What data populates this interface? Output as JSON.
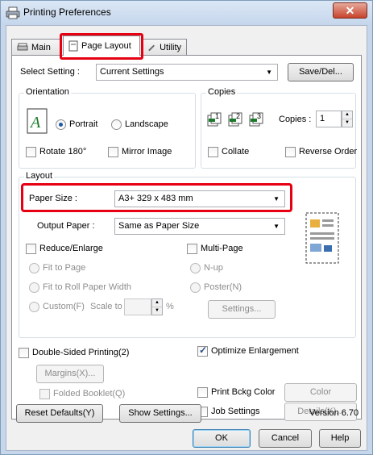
{
  "window": {
    "title": "Printing Preferences",
    "close_glyph": "✕"
  },
  "tabs": [
    "Main",
    "Page Layout",
    "Utility"
  ],
  "select_setting": {
    "label": "Select Setting :",
    "value": "Current Settings",
    "save_button": "Save/Del..."
  },
  "orientation": {
    "group_title": "Orientation",
    "portrait": "Portrait",
    "landscape": "Landscape",
    "selected": "Portrait",
    "rotate": "Rotate 180°",
    "mirror": "Mirror Image"
  },
  "copies": {
    "group_title": "Copies",
    "label": "Copies :",
    "value": "1",
    "collate": "Collate",
    "reverse": "Reverse Order",
    "icon_sets": [
      "1",
      "2",
      "3"
    ]
  },
  "layout": {
    "group_title": "Layout",
    "paper_size_label": "Paper Size :",
    "paper_size_value": "A3+ 329 x 483 mm",
    "output_paper_label": "Output Paper :",
    "output_paper_value": "Same as Paper Size",
    "reduce_enlarge": "Reduce/Enlarge",
    "fit_to_page": "Fit to Page",
    "fit_to_roll": "Fit to Roll Paper Width",
    "custom": "Custom(F)",
    "scale_to": "Scale to",
    "percent": "%",
    "multi_page": "Multi-Page",
    "n_up": "N-up",
    "poster": "Poster(N)",
    "settings_button": "Settings..."
  },
  "double_sided": {
    "label": "Double-Sided Printing(2)",
    "margins_button": "Margins(X)...",
    "folded_booklet": "Folded Booklet(Q)"
  },
  "optimize_enlargement": {
    "label": "Optimize Enlargement",
    "checked": true
  },
  "print_bckg": {
    "label": "Print Bckg Color",
    "button": "Color Settings(H)..."
  },
  "job_settings": {
    "label": "Job Settings",
    "button": "Details(K)..."
  },
  "footer": {
    "reset_button": "Reset Defaults(Y)",
    "show_settings_button": "Show Settings...",
    "version": "Version 6.70"
  },
  "dialog_buttons": {
    "ok": "OK",
    "cancel": "Cancel",
    "help": "Help"
  },
  "colors": {
    "highlight": "#e60012",
    "title_bar": "#c6d7ec",
    "close": "#c7432b"
  }
}
